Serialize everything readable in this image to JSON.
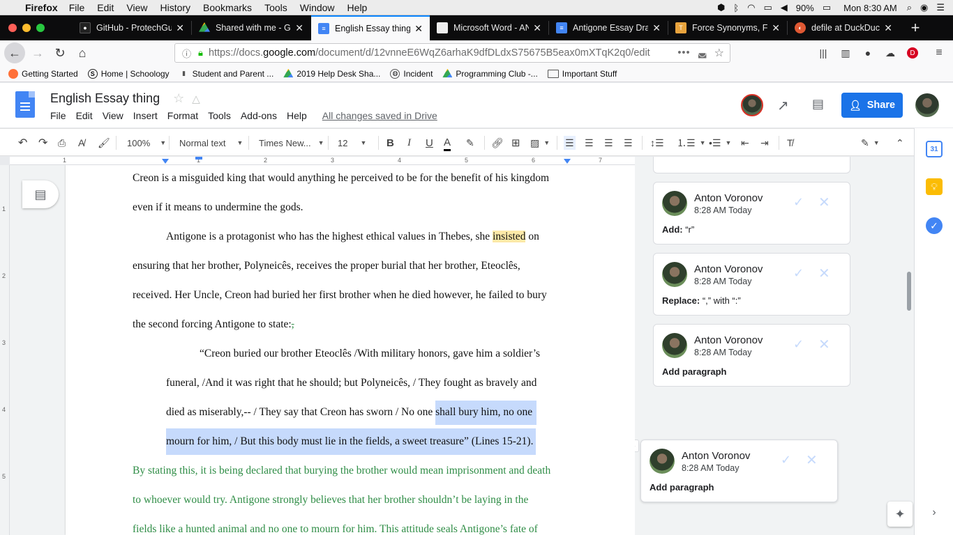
{
  "macos_menubar": {
    "app": "Firefox",
    "items": [
      "File",
      "Edit",
      "View",
      "History",
      "Bookmarks",
      "Tools",
      "Window",
      "Help"
    ],
    "battery": "90%",
    "clock": "Mon 8:30 AM"
  },
  "browser": {
    "tabs": [
      {
        "title": "GitHub - ProtechGuru",
        "icon": "github-icon",
        "active": false
      },
      {
        "title": "Shared with me - Google Drive",
        "icon": "drive-icon",
        "active": false
      },
      {
        "title": "English Essay thing - Google Docs",
        "icon": "docs-icon",
        "active": true
      },
      {
        "title": "Microsoft Word - ANTIGONE",
        "icon": "blank-page-icon",
        "active": false
      },
      {
        "title": "Antigone Essay Draft",
        "icon": "docs-icon",
        "active": false
      },
      {
        "title": "Force Synonyms, Force Antonyms",
        "icon": "thesaurus-icon",
        "active": false
      },
      {
        "title": "defile at DuckDuckGo",
        "icon": "duckduckgo-icon",
        "active": false
      }
    ],
    "url_prefix": "https://docs.",
    "url_domain": "google.com",
    "url_suffix": "/document/d/12vnneE6WqZ6arhaK9dfDLdxS75675B5eax0mXTqK2q0/edit",
    "bookmarks": [
      {
        "label": "Getting Started",
        "icon": "firefox-icon"
      },
      {
        "label": "Home | Schoology",
        "icon": "schoology-icon"
      },
      {
        "label": "Student and Parent ...",
        "icon": "bookmark-icon"
      },
      {
        "label": "2019 Help Desk Sha...",
        "icon": "drive-icon"
      },
      {
        "label": "Incident",
        "icon": "globe-icon"
      },
      {
        "label": "Programming Club -...",
        "icon": "drive-icon"
      },
      {
        "label": "Important Stuff",
        "icon": "folder-icon"
      }
    ]
  },
  "docs": {
    "title": "English Essay thing",
    "menu": [
      "File",
      "Edit",
      "View",
      "Insert",
      "Format",
      "Tools",
      "Add-ons",
      "Help"
    ],
    "saved_status": "All changes saved in Drive",
    "share_label": "Share"
  },
  "toolbar": {
    "zoom": "100%",
    "style": "Normal text",
    "font": "Times New...",
    "size": "12"
  },
  "ruler_numbers": [
    "1",
    "1",
    "2",
    "3",
    "4",
    "5",
    "6",
    "7"
  ],
  "vruler_numbers": [
    "1",
    "2",
    "3",
    "4",
    "5"
  ],
  "document_lines": [
    {
      "text": "Creon is a misguided king that would anything he perceived to be for the benefit of his kingdom",
      "style": "normal"
    },
    {
      "text": "even if it means to undermine the gods.",
      "style": "normal"
    },
    {
      "pre": "Antigone is a protagonist who has the highest ethical values in Thebes, she ",
      "hl": "insisted",
      "post": " on",
      "style": "normal"
    },
    {
      "text": "ensuring that her brother, Polyneicês, receives the proper burial that her brother, Eteoclês,",
      "style": "normal"
    },
    {
      "text": "received. Her Uncle, Creon had buried her first brother when he died however, he failed to bury",
      "style": "normal"
    },
    {
      "pre": "the second forcing Antigone to state:",
      "hl": ",",
      "post": "",
      "style": "normal"
    },
    {
      "text": "“Creon buried our brother Eteoclês /With military honors, gave him a soldier’s",
      "style": "normal"
    },
    {
      "text": "funeral, /And it was right that he should; but Polyneicês, / They fought as bravely and",
      "style": "normal"
    },
    {
      "pre": "died as miserably,-- / They say that Creon has sworn / No one ",
      "hl": "shall bury him, no one",
      "post": "",
      "style": "normal"
    },
    {
      "text": "mourn for him, /  But this body must lie in the fields, a sweet treasure” (Lines 15-21).",
      "style": "selected"
    },
    {
      "text": "By stating this, it is being declared that burying the brother would mean imprisonment and death",
      "style": "green"
    },
    {
      "text": "to whoever would try. Antigone strongly believes that her brother shouldn’t be laying in the",
      "style": "green"
    },
    {
      "text": "fields like a hunted animal and no one to mourn for him. This attitude seals Antigone’s fate of",
      "style": "green"
    }
  ],
  "comments": [
    {
      "author": "Anton Voronov",
      "time": "8:28 AM Today",
      "action": "Add:",
      "detail": " “r”"
    },
    {
      "author": "Anton Voronov",
      "time": "8:28 AM Today",
      "action": "Replace:",
      "detail": " “,” with “:”"
    },
    {
      "author": "Anton Voronov",
      "time": "8:28 AM Today",
      "action": "Add paragraph",
      "detail": ""
    },
    {
      "author": "Anton Voronov",
      "time": "8:28 AM Today",
      "action": "Add paragraph",
      "detail": ""
    }
  ],
  "colors": {
    "accent": "#1a73e8",
    "suggestion_green": "#2f8d46",
    "selection": "#c6dafc",
    "comment_highlight": "#fde9a8",
    "firefox_tab_bg": "#0c0c0d"
  }
}
